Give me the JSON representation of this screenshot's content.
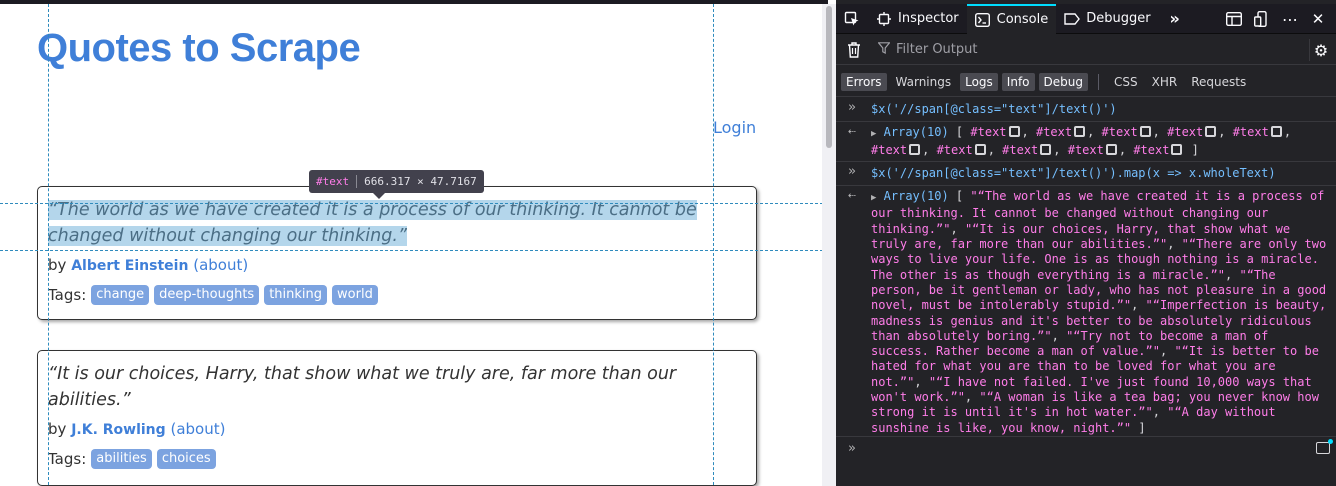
{
  "page": {
    "title": "Quotes to Scrape",
    "login": "Login",
    "tooltip": {
      "node": "#text",
      "dimensions": "666.317 × 47.7167"
    },
    "quotes": [
      {
        "text": "“The world as we have created it is a process of our thinking. It cannot be changed without changing our thinking.”",
        "by": "by",
        "author": "Albert Einstein",
        "about": "(about)",
        "tags_label": "Tags:",
        "tags": [
          "change",
          "deep-thoughts",
          "thinking",
          "world"
        ]
      },
      {
        "text": "“It is our choices, Harry, that show what we truly are, far more than our abilities.”",
        "by": "by",
        "author": "J.K. Rowling",
        "about": "(about)",
        "tags_label": "Tags:",
        "tags": [
          "abilities",
          "choices"
        ]
      }
    ]
  },
  "devtools": {
    "tabs": [
      "Inspector",
      "Console",
      "Debugger"
    ],
    "selected_tab": "Console",
    "filter_placeholder": "Filter Output",
    "categories": [
      {
        "label": "Errors",
        "on": true
      },
      {
        "label": "Warnings",
        "on": false
      },
      {
        "label": "Logs",
        "on": true
      },
      {
        "label": "Info",
        "on": true
      },
      {
        "label": "Debug",
        "on": true
      }
    ],
    "net_categories": [
      "CSS",
      "XHR",
      "Requests"
    ],
    "input1": "$x('//span[@class=\"text\"]/text()')",
    "output1_label": "Array(10)",
    "output1_nodes": [
      "#text",
      "#text",
      "#text",
      "#text",
      "#text",
      "#text",
      "#text",
      "#text",
      "#text",
      "#text"
    ],
    "input2": "$x('//span[@class=\"text\"]/text()').map(x => x.wholeText)",
    "output2_label": "Array(10)",
    "output2_strings": [
      "\"“The world as we have created it is a process of our thinking. It cannot be changed without changing our thinking.”\"",
      "\"“It is our choices, Harry, that show what we truly are, far more than our abilities.”\"",
      "\"“There are only two ways to live your life. One is as though nothing is a miracle. The other is as though everything is a miracle.”\"",
      "\"“The person, be it gentleman or lady, who has not pleasure in a good novel, must be intolerably stupid.”\"",
      "\"“Imperfection is beauty, madness is genius and it's better to be absolutely ridiculous than absolutely boring.”\"",
      "\"“Try not to become a man of success. Rather become a man of value.”\"",
      "\"“It is better to be hated for what you are than to be loved for what you are not.”\"",
      "\"“I have not failed. I've just found 10,000 ways that won't work.”\"",
      "\"“A woman is like a tea bag; you never know how strong it is until it's in hot water.”\"",
      "\"“A day without sunshine is like, you know, night.”\""
    ]
  }
}
